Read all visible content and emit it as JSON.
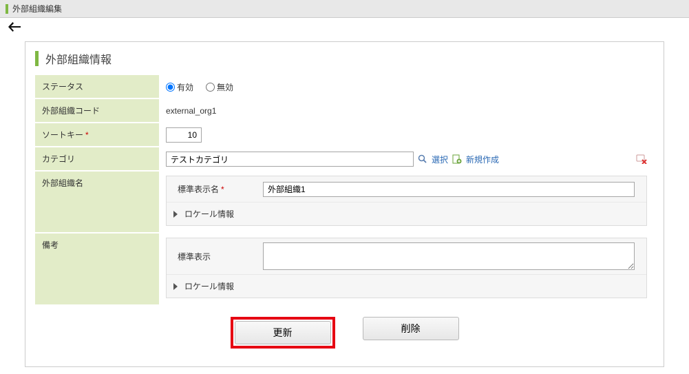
{
  "header": {
    "title": "外部組織編集"
  },
  "section": {
    "title": "外部組織情報"
  },
  "labels": {
    "status": "ステータス",
    "orgCode": "外部組織コード",
    "sortKey": "ソートキー",
    "category": "カテゴリ",
    "orgName": "外部組織名",
    "remarks": "備考",
    "stdDisplayName": "標準表示名",
    "stdDisplay": "標準表示",
    "localeInfo": "ロケール情報"
  },
  "status": {
    "enabled": "有効",
    "disabled": "無効",
    "selected": "enabled"
  },
  "values": {
    "orgCode": "external_org1",
    "sortKey": "10",
    "category": "テストカテゴリ",
    "stdDisplayName": "外部組織1",
    "remarks": ""
  },
  "actions": {
    "select": "選択",
    "create": "新規作成",
    "update": "更新",
    "delete": "削除"
  }
}
